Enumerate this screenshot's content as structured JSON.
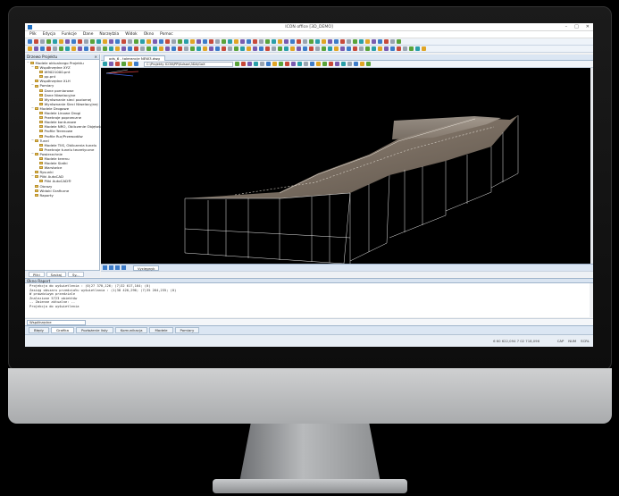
{
  "window": {
    "title": "ICON office [3D_DEMO]"
  },
  "menu": [
    "Plik",
    "Edycja",
    "Funkcje",
    "Dane",
    "Narzędzia",
    "Widok",
    "Okno",
    "Pomoc"
  ],
  "left_panel": {
    "title": "Drzewo Projektu",
    "tree": [
      {
        "label": "Modele aktualnego Projektu",
        "depth": 0,
        "twisty": "−"
      },
      {
        "label": "Współrzędne XYZ",
        "depth": 1,
        "twisty": "−"
      },
      {
        "label": "W9021000.pnt",
        "depth": 2,
        "twisty": ""
      },
      {
        "label": "pp.pnt",
        "depth": 2,
        "twisty": ""
      },
      {
        "label": "Współrzędne XLH",
        "depth": 1,
        "twisty": ""
      },
      {
        "label": "Pomiary",
        "depth": 1,
        "twisty": "−"
      },
      {
        "label": "Dane pomiarowe",
        "depth": 2,
        "twisty": ""
      },
      {
        "label": "Dane Niwelacyjne",
        "depth": 2,
        "twisty": ""
      },
      {
        "label": "Wyrównanie sieci poziomej",
        "depth": 2,
        "twisty": ""
      },
      {
        "label": "Wyrównanie Sieci Niwelacyjnej",
        "depth": 2,
        "twisty": ""
      },
      {
        "label": "Modele Drogowe",
        "depth": 1,
        "twisty": "−"
      },
      {
        "label": "Modele Linowe Drogi",
        "depth": 2,
        "twisty": ""
      },
      {
        "label": "Przekroje poprzeczne",
        "depth": 2,
        "twisty": ""
      },
      {
        "label": "Modele konturowe",
        "depth": 2,
        "twisty": ""
      },
      {
        "label": "Modele NRO, Obliczenie Objętości",
        "depth": 2,
        "twisty": ""
      },
      {
        "label": "Profile Terenowe",
        "depth": 2,
        "twisty": ""
      },
      {
        "label": "Profile Rur/Przewodów",
        "depth": 2,
        "twisty": ""
      },
      {
        "label": "Tunel",
        "depth": 1,
        "twisty": "−"
      },
      {
        "label": "Modele TIIS, Obliczenia tunelu",
        "depth": 2,
        "twisty": ""
      },
      {
        "label": "Przekroje tunelu teoretyczne",
        "depth": 2,
        "twisty": ""
      },
      {
        "label": "Powierzchnie",
        "depth": 1,
        "twisty": "−"
      },
      {
        "label": "Modele terenu",
        "depth": 2,
        "twisty": ""
      },
      {
        "label": "Modele Siatki",
        "depth": 2,
        "twisty": ""
      },
      {
        "label": "Warstwice",
        "depth": 2,
        "twisty": ""
      },
      {
        "label": "Rysunki",
        "depth": 1,
        "twisty": ""
      },
      {
        "label": "Pliki AutoCAD",
        "depth": 1,
        "twisty": "−"
      },
      {
        "label": "Pliki AutoCAD®",
        "depth": 2,
        "twisty": ""
      },
      {
        "label": "Obrazy",
        "depth": 1,
        "twisty": ""
      },
      {
        "label": "Widoki Graficzne",
        "depth": 1,
        "twisty": ""
      },
      {
        "label": "Raporty",
        "depth": 1,
        "twisty": ""
      }
    ],
    "tabs": [
      "Pliki",
      "Szukaj",
      "Sy..."
    ]
  },
  "document_tab": "ods_6 - tolerancje NEW3.dwg",
  "view_path": "C:\\Projekty ICON\\PP\\Kulsan\\3DA\\GaX",
  "view_bottom_tab": "Vycięgnyk",
  "output": {
    "title": "Okno Raport",
    "lines": [
      "Projekcja do wyświetlenia    : (0)27 370,126; (7)32 617,164; (0)",
      "Zasięg obszaru przedziału wyświetlania    : (1)38 420,296; (7)35 264,235; (0)",
      "W prawdziwym przedziale",
      "Znalezione 5723 obiektów",
      "-- Zmienne aktualne: --",
      "Projekcja do wyświetlenia"
    ]
  },
  "command": {
    "value": "Współrzędne"
  },
  "bottom_tabs": [
    "Błędy",
    "Grafika",
    "Pozłożenie listy",
    "Komunikacja",
    "Modele",
    "Pomiary"
  ],
  "status": {
    "coords": "6 60 622,094  7 02 718,096",
    "flags": [
      "CAP",
      "NUM",
      "SCRL"
    ]
  },
  "colors": {
    "accent": "#1f6fc2",
    "panel": "#d9e4f1",
    "viewport_bg": "#000000",
    "road_surface": "#8a7e72"
  }
}
